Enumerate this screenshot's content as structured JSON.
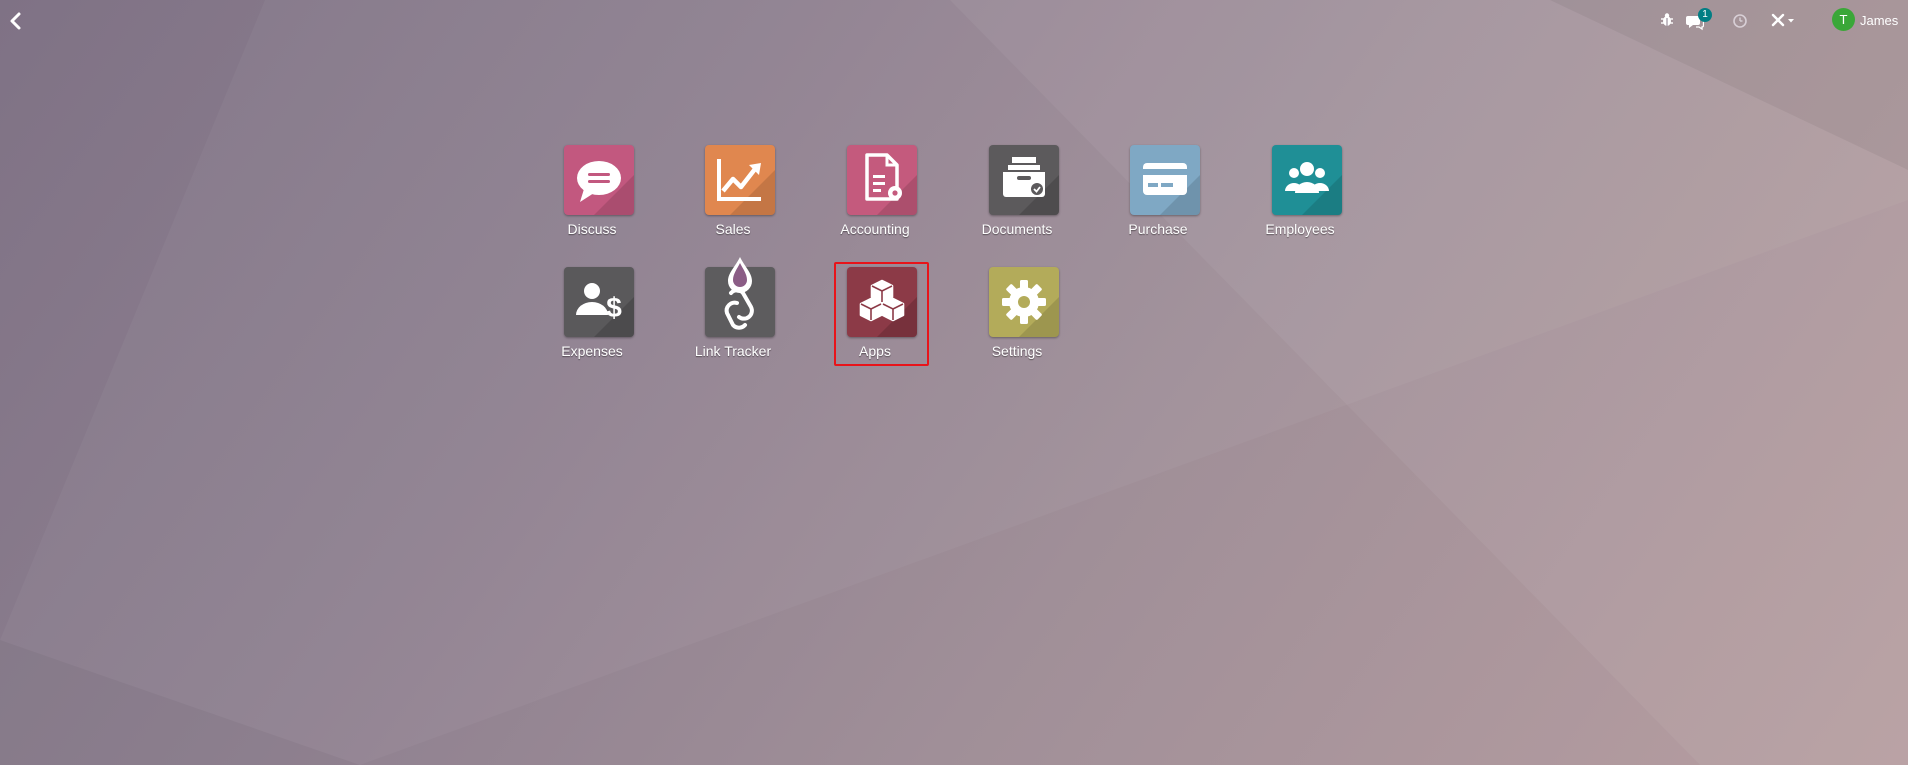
{
  "topbar": {
    "back_icon": "chevron-left-icon",
    "debug_icon": "bug-icon",
    "messaging_icon": "chat-bubbles-icon",
    "messaging_count": "1",
    "activity_icon": "clock-icon",
    "tools_icon": "tools-icon",
    "user": {
      "initial": "T",
      "name": "James",
      "avatar_color": "#3aa738"
    }
  },
  "apps": [
    {
      "label": "Discuss",
      "icon": "chat-bubble-icon",
      "color": "#c2587f"
    },
    {
      "label": "Sales",
      "icon": "trend-chart-icon",
      "color": "#e0874f"
    },
    {
      "label": "Accounting",
      "icon": "invoice-gear-icon",
      "color": "#c45a7d"
    },
    {
      "label": "Documents",
      "icon": "inbox-tray-icon",
      "color": "#5c5a5c"
    },
    {
      "label": "Purchase",
      "icon": "credit-card-icon",
      "color": "#7fa8c4"
    },
    {
      "label": "Employees",
      "icon": "people-icon",
      "color": "#1f8f96"
    },
    {
      "label": "Expenses",
      "icon": "user-dollar-icon",
      "color": "#5a595b"
    },
    {
      "label": "Link Tracker",
      "icon": "drop-link-icon",
      "color": "#5d5c5e"
    },
    {
      "label": "Apps",
      "icon": "cubes-icon",
      "color": "#8c3a47",
      "highlighted": true
    },
    {
      "label": "Settings",
      "icon": "gear-icon",
      "color": "#b3ab5a"
    }
  ],
  "colors": {
    "highlight": "#e8141a",
    "badge": "#017e84"
  }
}
